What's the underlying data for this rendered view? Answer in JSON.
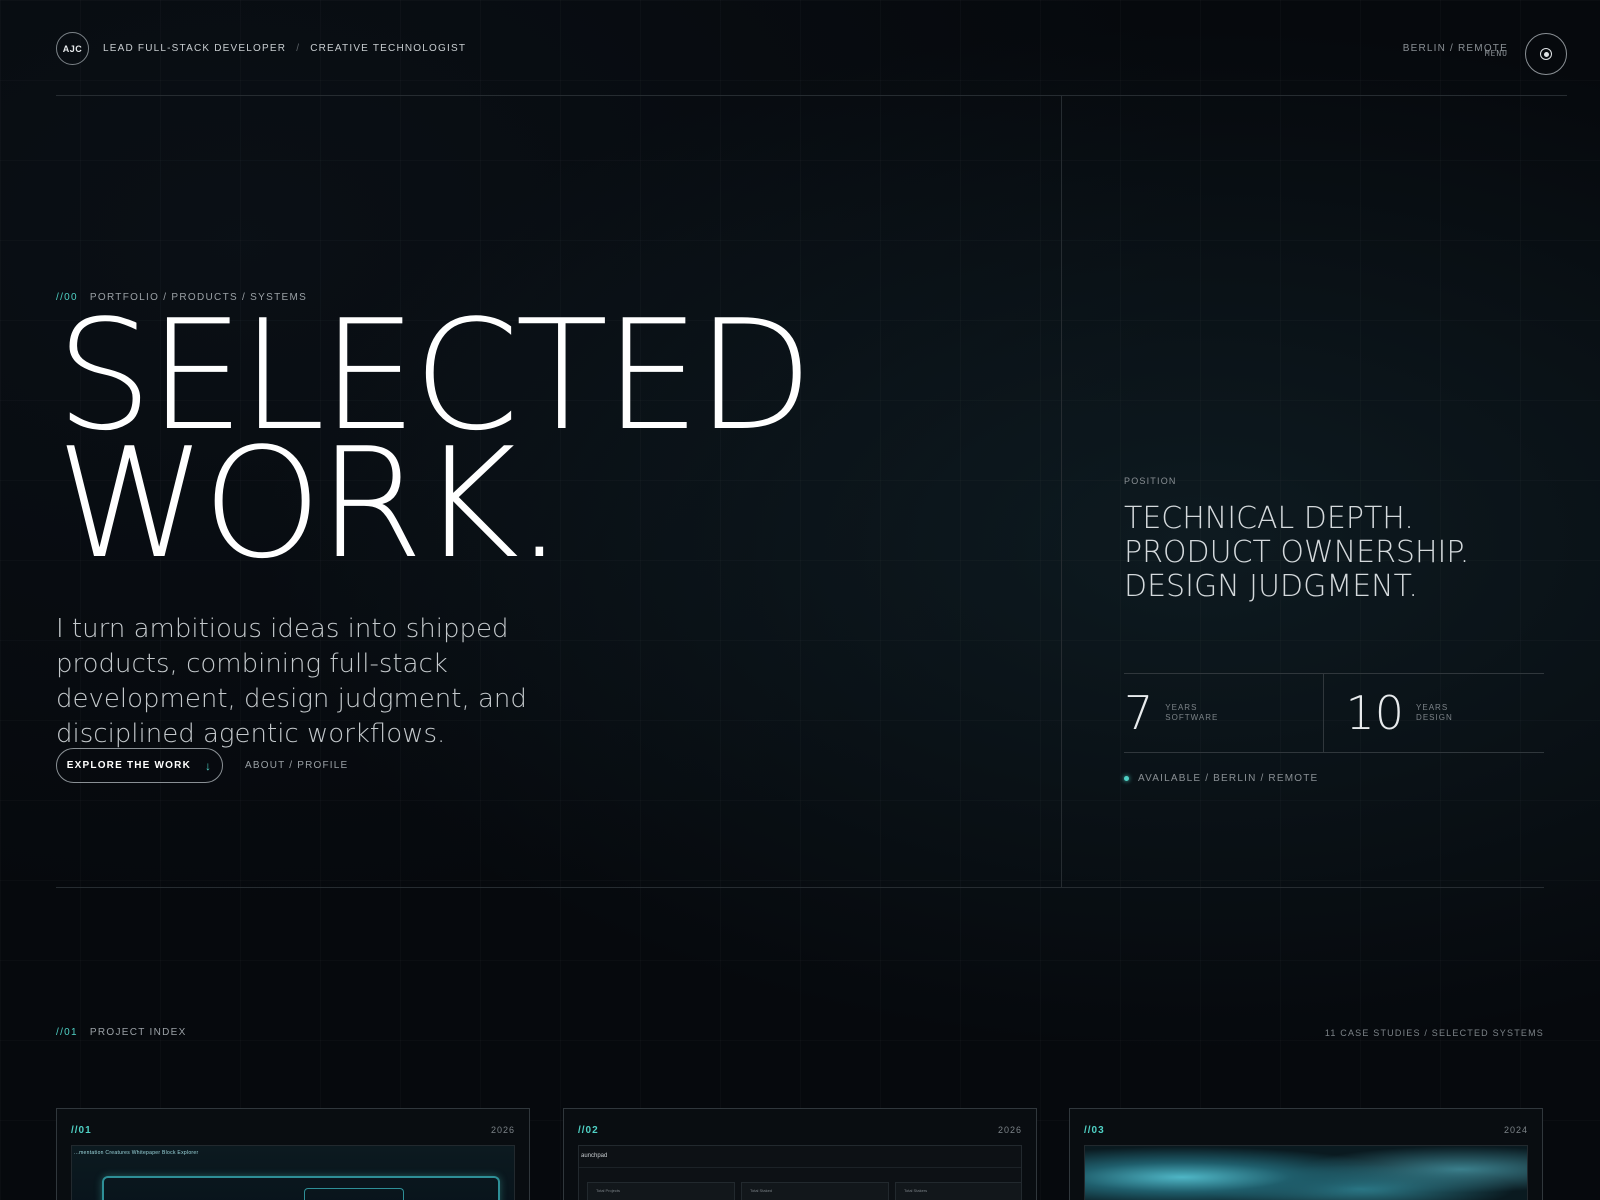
{
  "header": {
    "logo": "AJC",
    "role_primary": "LEAD FULL-STACK DEVELOPER",
    "role_separator": "/",
    "role_secondary": "CREATIVE TECHNOLOGIST",
    "location": "BERLIN / REMOTE",
    "menu_label": "MENU"
  },
  "hero": {
    "eyebrow_num": "//00",
    "eyebrow_text": "PORTFOLIO / PRODUCTS / SYSTEMS",
    "title_line1": "SELECTED",
    "title_line2": "WORK.",
    "description": "I turn ambitious ideas into shipped products, combining full-stack development, design judgment, and disciplined agentic workflows.",
    "cta_label": "EXPLORE THE WORK",
    "cta_arrow": "↓",
    "about_link": "ABOUT / PROFILE"
  },
  "position": {
    "label": "POSITION",
    "lines": [
      "TECHNICAL DEPTH.",
      "PRODUCT OWNERSHIP.",
      "DESIGN JUDGMENT."
    ],
    "stats": [
      {
        "value": "7",
        "label_line1": "YEARS",
        "label_line2": "SOFTWARE"
      },
      {
        "value": "10",
        "label_line1": "YEARS",
        "label_line2": "DESIGN"
      }
    ],
    "availability": "AVAILABLE / BERLIN / REMOTE"
  },
  "project_index": {
    "num": "//01",
    "label": "PROJECT INDEX",
    "count_text": "11 CASE STUDIES / SELECTED SYSTEMS",
    "cards": [
      {
        "num": "//01",
        "year": "2026",
        "thumb_nav": "...mentation  Creatures  Whitepaper  Block Explorer"
      },
      {
        "num": "//02",
        "year": "2026",
        "thumb_app": "aunchpad",
        "thumb_stats": [
          "Total Projects",
          "Total Staked",
          "Total Stakers"
        ]
      },
      {
        "num": "//03",
        "year": "2024"
      }
    ]
  },
  "colors": {
    "background": "#06090d",
    "accent": "#4fd1c5",
    "text": "#dfe3e6",
    "muted": "#8a9095"
  }
}
